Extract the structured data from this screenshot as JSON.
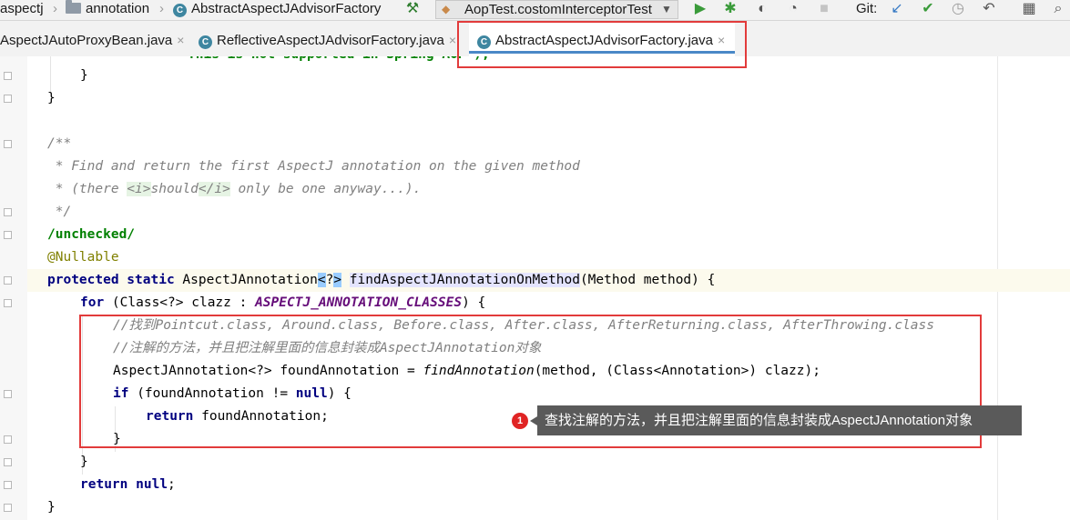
{
  "navbar": {
    "breadcrumbs": [
      "aspectj",
      "annotation",
      "AbstractAspectJAdvisorFactory"
    ],
    "run_config": "AopTest.costomInterceptorTest",
    "git_label": "Git:"
  },
  "tabs": [
    {
      "label": "AspectJAutoProxyBean.java",
      "close": "×"
    },
    {
      "label": "ReflectiveAspectJAdvisorFactory.java",
      "close": "×"
    },
    {
      "label": "AbstractAspectJAdvisorFactory.java",
      "close": "×",
      "active": true
    }
  ],
  "code": {
    "cut_line": "This is not supported in Spring AOP\");",
    "l1": "}",
    "l2": "}",
    "l3": "/**",
    "l4": " * Find and return the first AspectJ annotation on the given method",
    "l5a": " * (there ",
    "l5b": "<i>",
    "l5c": "should",
    "l5d": "</i>",
    "l5e": " only be one anyway...).",
    "l6": " */",
    "l7": "/unchecked/",
    "l8": "@Nullable",
    "l9a": "protected static",
    "l9b": " AspectJAnnotation",
    "l9c": "<",
    "l9d": "?",
    "l9e": ">",
    "l9f": " ",
    "l9g": "findAspectJAnnotationOnMethod",
    "l9h": "(Method method) {",
    "l10a": "for",
    "l10b": " (Class<?> clazz : ",
    "l10c": "ASPECTJ_ANNOTATION_CLASSES",
    "l10d": ") {",
    "l11": "//找到Pointcut.class, Around.class, Before.class, After.class, AfterReturning.class, AfterThrowing.class",
    "l12": "//注解的方法，并且把注解里面的信息封装成AspectJAnnotation对象",
    "l13a": "AspectJAnnotation<?> foundAnnotation = ",
    "l13b": "findAnnotation",
    "l13c": "(method, (Class<Annotation>) clazz);",
    "l14a": "if",
    "l14b": " (foundAnnotation != ",
    "l14c": "null",
    "l14d": ") {",
    "l15a": "return",
    "l15b": " foundAnnotation;",
    "l16": "}",
    "l17": "}",
    "l18a": "return",
    "l18b": " ",
    "l18c": "null",
    "l18d": ";",
    "l19": "}"
  },
  "callout": {
    "badge": "1",
    "text": "查找注解的方法，并且把注解里面的信息封装成AspectJAnnotation对象"
  },
  "colors": {
    "keyword": "#000080",
    "comment": "#808080",
    "annotation": "#808000",
    "static_field": "#660e7a",
    "highlight_box": "#e23b3b"
  }
}
